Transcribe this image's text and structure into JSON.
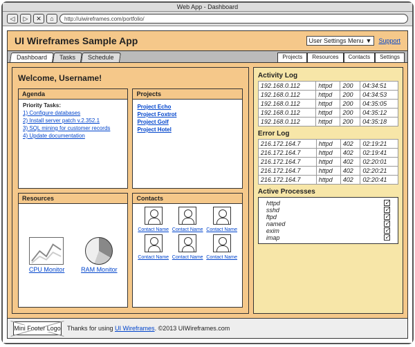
{
  "browser": {
    "title": "Web App - Dashboard",
    "url": "http://uiwireframes.com/portfolio/"
  },
  "app": {
    "title": "UI Wireframes Sample App",
    "user_menu": "User Settings Menu",
    "support": "Support"
  },
  "tabs_left": [
    "Dashboard",
    "Tasks",
    "Schedule"
  ],
  "tabs_right": [
    "Projects",
    "Resources",
    "Contacts",
    "Settings"
  ],
  "main": {
    "welcome": "Welcome, Username!",
    "agenda": {
      "title": "Agenda",
      "subtitle": "Priority Tasks:",
      "tasks": [
        "1) Configure databases",
        "2) Install server patch v.2.352.1",
        "3) SQL mining for customer records",
        "4) Update documentation"
      ]
    },
    "projects": {
      "title": "Projects",
      "items": [
        "Project Echo",
        "Project Foxtrot",
        "Project Golf",
        "Project Hotel"
      ]
    },
    "resources": {
      "title": "Resources",
      "cpu": "CPU Monitor",
      "ram": "RAM Monitor"
    },
    "contacts": {
      "title": "Contacts",
      "label": "Contact Name"
    }
  },
  "side": {
    "activity": {
      "title": "Activity Log",
      "rows": [
        [
          "192.168.0.112",
          "httpd",
          "200",
          "04:34:51"
        ],
        [
          "192.168.0.112",
          "httpd",
          "200",
          "04:34:53"
        ],
        [
          "192.168.0.112",
          "httpd",
          "200",
          "04:35:05"
        ],
        [
          "192.168.0.112",
          "httpd",
          "200",
          "04:35:12"
        ],
        [
          "192.168.0.112",
          "httpd",
          "200",
          "04:35:18"
        ]
      ]
    },
    "error": {
      "title": "Error Log",
      "rows": [
        [
          "216.172.164.7",
          "httpd",
          "402",
          "02:19:21"
        ],
        [
          "216.172.164.7",
          "httpd",
          "402",
          "02:19:41"
        ],
        [
          "216.172.164.7",
          "httpd",
          "402",
          "02:20:01"
        ],
        [
          "216.172.164.7",
          "httpd",
          "402",
          "02:20:21"
        ],
        [
          "216.172.164.7",
          "httpd",
          "402",
          "02:20:41"
        ]
      ]
    },
    "processes": {
      "title": "Active Processes",
      "items": [
        {
          "name": "httpd",
          "on": true
        },
        {
          "name": "sshd",
          "on": true
        },
        {
          "name": "ftpd",
          "on": true
        },
        {
          "name": "named",
          "on": true
        },
        {
          "name": "exim",
          "on": true
        },
        {
          "name": "imap",
          "on": true
        }
      ]
    }
  },
  "footer": {
    "logo": "Mini Footer Logo",
    "text_pre": "Thanks for using ",
    "link": "UI Wireframes",
    "text_post": ". ©2013 UIWireframes.com"
  }
}
